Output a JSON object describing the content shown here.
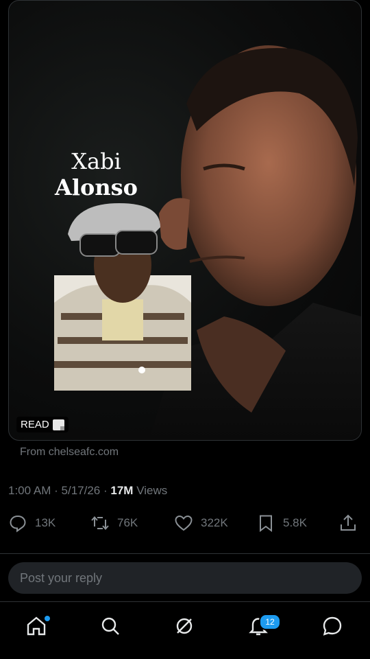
{
  "media": {
    "headline_line1": "Xabi",
    "headline_line2": "Alonso",
    "read_label": "READ",
    "read_icon": "page-icon"
  },
  "source": "From chelseafc.com",
  "meta": {
    "time": "1:00 AM",
    "date": "5/17/26",
    "separator": "·",
    "views_count": "17M",
    "views_label": "Views"
  },
  "actions": {
    "replies": "13K",
    "reposts": "76K",
    "likes": "322K",
    "bookmarks": "5.8K"
  },
  "reply": {
    "placeholder": "Post your reply"
  },
  "nav": {
    "notifications_badge": "12"
  },
  "colors": {
    "accent": "#1d9bf0",
    "muted_text": "#71767b",
    "primary_text": "#e7e9ea",
    "background": "#000000"
  }
}
